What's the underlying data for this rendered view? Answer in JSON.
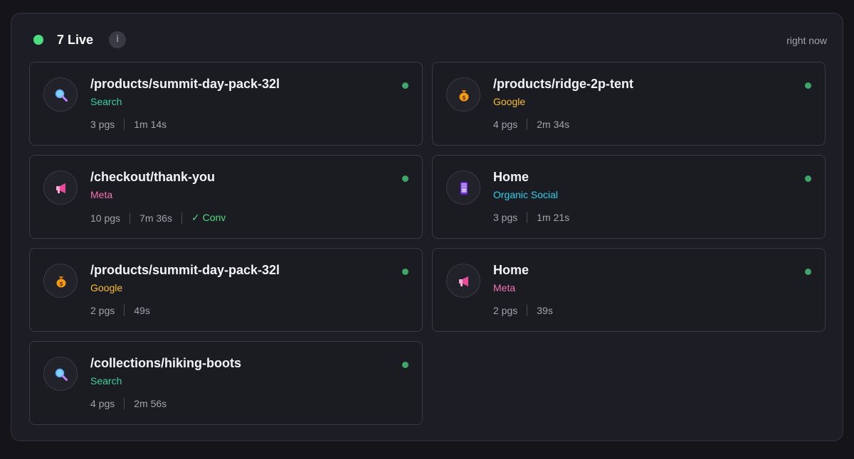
{
  "header": {
    "live_count": "7 Live",
    "info_label": "i",
    "updated": "right now"
  },
  "colors": {
    "live": "#4ade80",
    "search": "#34d399",
    "google": "#fbbf24",
    "meta": "#f472b6",
    "organic_social": "#22d3ee"
  },
  "sessions": [
    {
      "page": "/products/summit-day-pack-32l",
      "source": "Search",
      "icon": "magnifier-icon",
      "pages": "3 pgs",
      "duration": "1m 14s",
      "conv": ""
    },
    {
      "page": "/products/ridge-2p-tent",
      "source": "Google",
      "icon": "money-bag-icon",
      "pages": "4 pgs",
      "duration": "2m 34s",
      "conv": ""
    },
    {
      "page": "/checkout/thank-you",
      "source": "Meta",
      "icon": "megaphone-icon",
      "pages": "10 pgs",
      "duration": "7m 36s",
      "conv": "✓ Conv"
    },
    {
      "page": "Home",
      "source": "Organic Social",
      "icon": "phone-icon",
      "pages": "3 pgs",
      "duration": "1m 21s",
      "conv": ""
    },
    {
      "page": "/products/summit-day-pack-32l",
      "source": "Google",
      "icon": "money-bag-icon",
      "pages": "2 pgs",
      "duration": "49s",
      "conv": ""
    },
    {
      "page": "Home",
      "source": "Meta",
      "icon": "megaphone-icon",
      "pages": "2 pgs",
      "duration": "39s",
      "conv": ""
    },
    {
      "page": "/collections/hiking-boots",
      "source": "Search",
      "icon": "magnifier-icon",
      "pages": "4 pgs",
      "duration": "2m 56s",
      "conv": ""
    }
  ]
}
